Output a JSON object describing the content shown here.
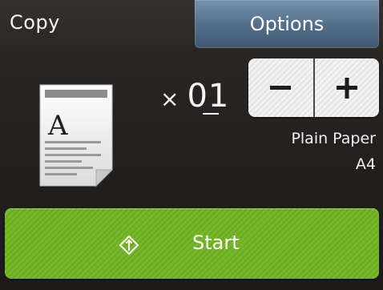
{
  "header": {
    "title": "Copy",
    "options_label": "Options"
  },
  "copies": {
    "multiplier_symbol": "×",
    "count": "01",
    "decrement_label": "−",
    "increment_label": "+"
  },
  "paper": {
    "type": "Plain Paper",
    "size": "A4"
  },
  "start": {
    "label": "Start",
    "icon": "start-diamond-icon"
  },
  "document_icon": {
    "icon": "document-icon",
    "glyph": "A"
  },
  "colors": {
    "options_button": "#55708a",
    "start_button": "#76b82a",
    "stepper_button": "#f3f3f3",
    "background": "#252120"
  }
}
